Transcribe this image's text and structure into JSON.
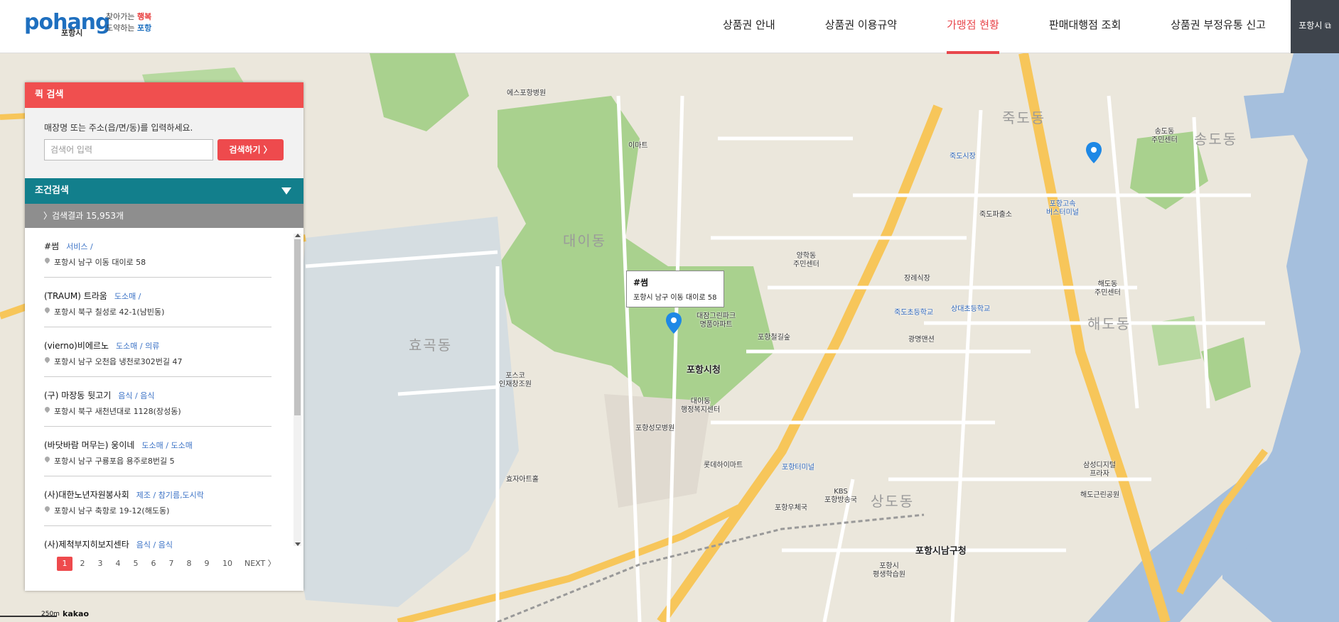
{
  "header": {
    "logo_text": "pohang",
    "logo_city": "포항시",
    "slogan_1": "찾아가는 ",
    "slogan_2": "행복",
    "slogan_3": "도약하는 ",
    "slogan_4": "포항",
    "nav": [
      {
        "label": "상품권 안내"
      },
      {
        "label": "상품권 이용규약"
      },
      {
        "label": "가맹점 현황"
      },
      {
        "label": "판매대행점 조회"
      },
      {
        "label": "상품권 부정유통 신고"
      }
    ],
    "city_link": "포항시 ⧉"
  },
  "panel": {
    "quick_title": "퀵 검색",
    "hint": "매장명 또는 주소(읍/면/동)를 입력하세요.",
    "search_placeholder": "검색어 입력",
    "search_button": "검색하기 〉",
    "condition_title": "조건검색",
    "result_count": "〉검색결과 15,953개",
    "items": [
      {
        "name": "#썸",
        "category": "서비스 /",
        "address": "포항시 남구 이동 대이로 58"
      },
      {
        "name": "(TRAUM) 트라움",
        "category": "도소매 /",
        "address": "포항시 북구 칠성로 42-1(남빈동)"
      },
      {
        "name": "(vierno)비에르노",
        "category": "도소매 / 의류",
        "address": "포항시 남구 오천읍 냉천로302번길 47"
      },
      {
        "name": "(구) 마장동 뒷고기",
        "category": "음식 / 음식",
        "address": "포항시 북구 새천년대로 1128(장성동)"
      },
      {
        "name": "(바닷바람 머무는) 웅이네",
        "category": "도소매 / 도소매",
        "address": "포항시 남구 구룡포읍 용주로8번길 5"
      },
      {
        "name": "(사)대한노년자원봉사회",
        "category": "제조 / 참기름,도시락",
        "address": "포항시 남구 축항로 19-12(해도동)"
      },
      {
        "name": "(사)제척부지히보지센타",
        "category": "음식 / 음식",
        "address": ""
      }
    ],
    "pages": [
      "1",
      "2",
      "3",
      "4",
      "5",
      "6",
      "7",
      "8",
      "9",
      "10"
    ],
    "next": "NEXT 〉"
  },
  "tooltip": {
    "title": "#썸",
    "address": "포항시 남구 이동 대이로 58"
  },
  "map": {
    "kakao": "kakao",
    "scale": "250m",
    "labels": {
      "daeidong": "대이동",
      "hyogokdong": "효곡동",
      "jukdodong": "죽도동",
      "haedodong": "해도동",
      "sangdodong": "상도동",
      "songdodong": "송도동",
      "cityhall": "포항시청",
      "namgu": "포항시남구청",
      "yangdeok": "양학동\n주민센터",
      "mart": "이마트",
      "bus": "포항고속\n버스터미널",
      "esp": "에스포항병원",
      "daejam": "대잠그린파크\n명품아파트",
      "daeidong_center": "대이동\n행정복지센터",
      "posco": "포스코\n인재창조원",
      "seongmo": "포항성모병원",
      "hyoja": "효자아트홀",
      "jukdo_market": "죽도시장",
      "cheolgil": "포항철길숲",
      "jukdo_church": "죽도초등학교",
      "sangdo_church": "상대초등학교",
      "haedo_center": "해도동\n주민센터",
      "songdo_center": "송도동\n주민센터",
      "samsung": "삼성디지털\n프라자",
      "haedogeun": "해도근린공원",
      "jukdomarket2": "죽도파출소",
      "kbs": "KBS\n포항방송국",
      "terminal": "포항터미널",
      "lotte": "롯데하이마트",
      "pohang_post": "포항우체국",
      "jangdeok": "장례식장",
      "gwangmyeong": "광명맨션",
      "haedoshi": "포항시\n평생학습원"
    }
  }
}
